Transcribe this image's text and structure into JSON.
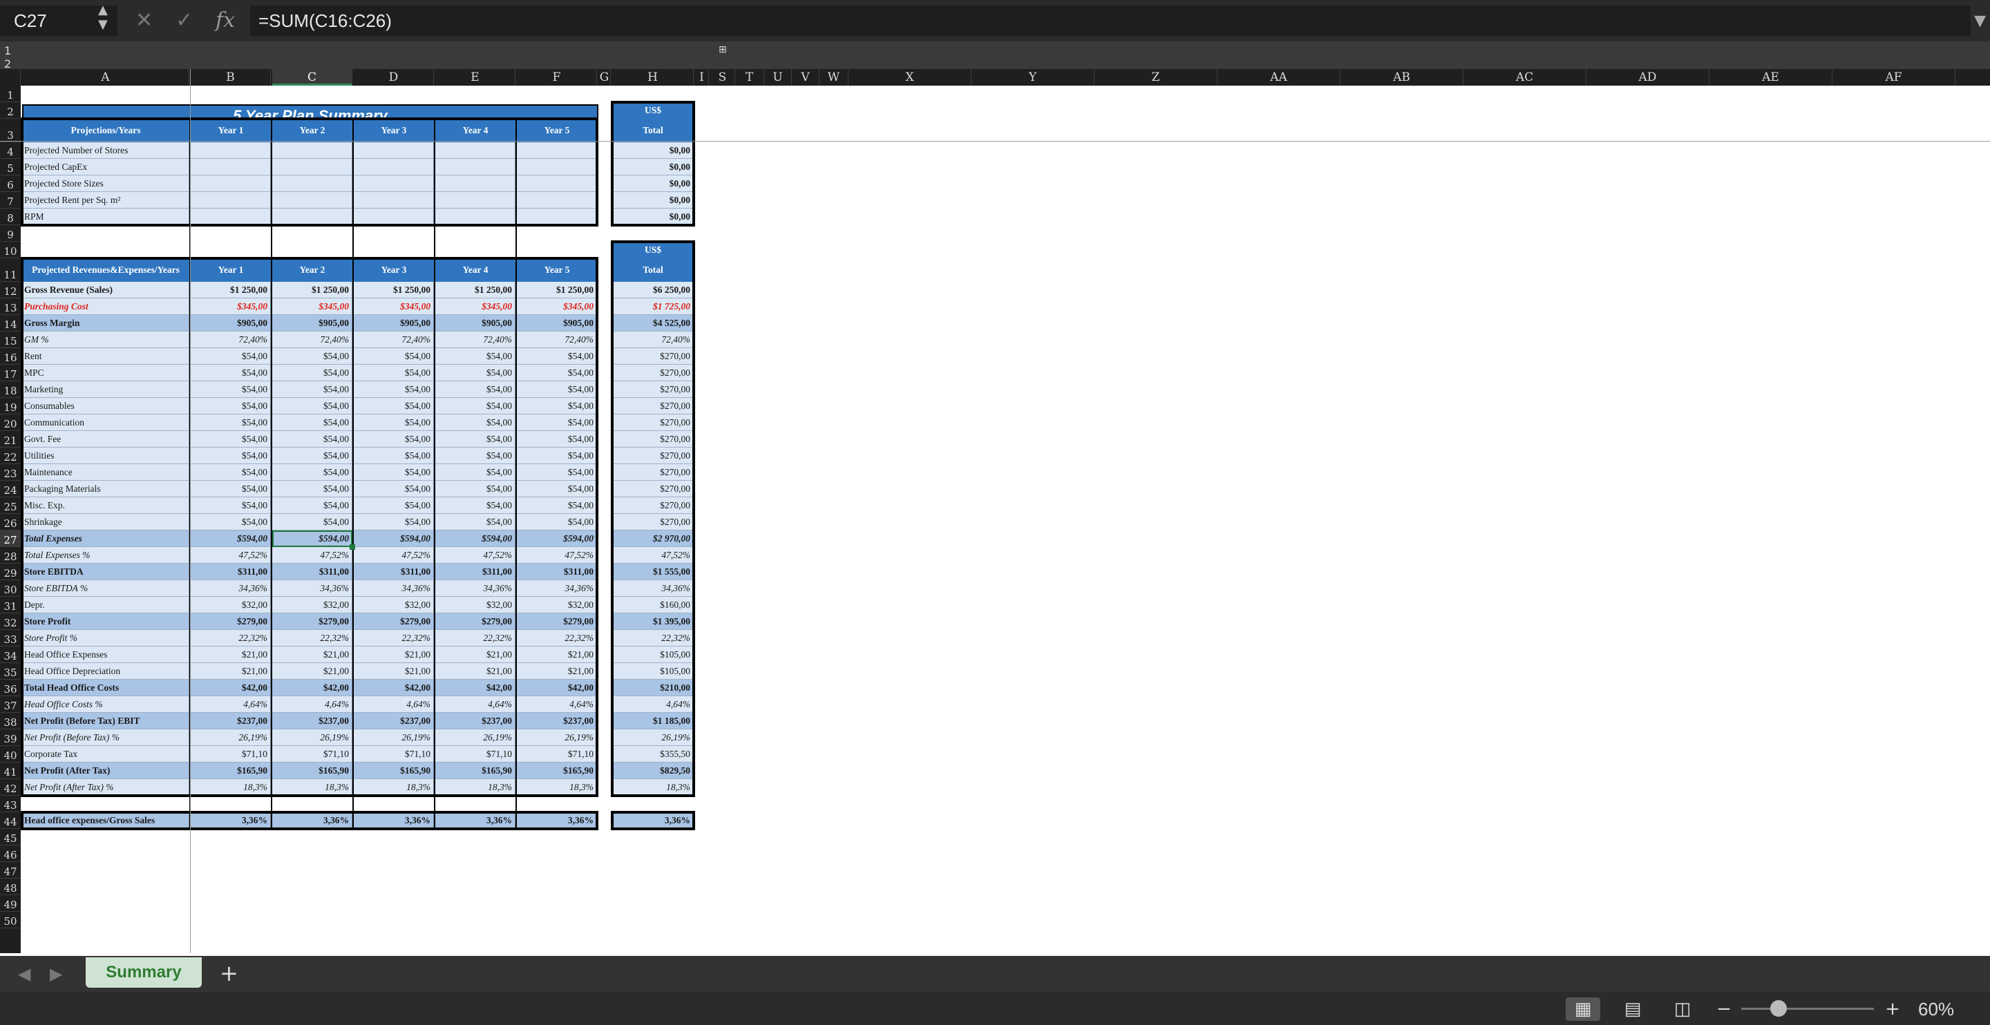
{
  "formula_bar": {
    "name_box": "C27",
    "formula": "=SUM(C16:C26)",
    "fx_label": "fx"
  },
  "columns": [
    "A",
    "B",
    "C",
    "D",
    "E",
    "F",
    "G",
    "H",
    "I",
    "S",
    "T",
    "U",
    "V",
    "W",
    "X",
    "Y",
    "Z",
    "AA",
    "AB",
    "AC",
    "AD",
    "AE",
    "AF"
  ],
  "selected_column": "C",
  "selected_row": 27,
  "rows": [
    1,
    2,
    3,
    4,
    5,
    6,
    7,
    8,
    9,
    10,
    11,
    12,
    13,
    14,
    15,
    16,
    17,
    18,
    19,
    20,
    21,
    22,
    23,
    24,
    25,
    26,
    27,
    28,
    29,
    30,
    31,
    32,
    33,
    34,
    35,
    36,
    37,
    38,
    39,
    40,
    41,
    42,
    43,
    44,
    45,
    46,
    47,
    48,
    49,
    50
  ],
  "sheet": {
    "title": "5 Year Plan Summary",
    "currency_label": "US$",
    "total_label": "Total",
    "years": [
      "Year 1",
      "Year 2",
      "Year 3",
      "Year 4",
      "Year 5"
    ],
    "projections": {
      "header": "Projections/Years",
      "rows": [
        {
          "label": "Projected Number of Stores",
          "total": "$0,00"
        },
        {
          "label": "Projected CapEx",
          "total": "$0,00"
        },
        {
          "label": "Projected Store Sizes",
          "total": "$0,00"
        },
        {
          "label": "Projected Rent per Sq. m²",
          "total": "$0,00"
        },
        {
          "label": "RPM",
          "total": "$0,00"
        }
      ]
    },
    "revenues": {
      "header": "Projected Revenues&Expenses/Years",
      "rows": [
        {
          "row": 12,
          "label": "Gross Revenue (Sales)",
          "style": "bold",
          "values": [
            "$1 250,00",
            "$1 250,00",
            "$1 250,00",
            "$1 250,00",
            "$1 250,00"
          ],
          "total": "$6 250,00"
        },
        {
          "row": 13,
          "label": "Purchasing Cost",
          "style": "red",
          "values": [
            "$345,00",
            "$345,00",
            "$345,00",
            "$345,00",
            "$345,00"
          ],
          "total": "$1 725,00"
        },
        {
          "row": 14,
          "label": "Gross Margin",
          "style": "mid",
          "values": [
            "$905,00",
            "$905,00",
            "$905,00",
            "$905,00",
            "$905,00"
          ],
          "total": "$4 525,00"
        },
        {
          "row": 15,
          "label": "GM %",
          "style": "italic",
          "values": [
            "72,40%",
            "72,40%",
            "72,40%",
            "72,40%",
            "72,40%"
          ],
          "total": "72,40%"
        },
        {
          "row": 16,
          "label": "Rent",
          "style": "plain",
          "values": [
            "$54,00",
            "$54,00",
            "$54,00",
            "$54,00",
            "$54,00"
          ],
          "total": "$270,00"
        },
        {
          "row": 17,
          "label": "MPC",
          "style": "plain",
          "values": [
            "$54,00",
            "$54,00",
            "$54,00",
            "$54,00",
            "$54,00"
          ],
          "total": "$270,00"
        },
        {
          "row": 18,
          "label": "Marketing",
          "style": "plain",
          "values": [
            "$54,00",
            "$54,00",
            "$54,00",
            "$54,00",
            "$54,00"
          ],
          "total": "$270,00"
        },
        {
          "row": 19,
          "label": "Consumables",
          "style": "plain",
          "values": [
            "$54,00",
            "$54,00",
            "$54,00",
            "$54,00",
            "$54,00"
          ],
          "total": "$270,00"
        },
        {
          "row": 20,
          "label": "Communication",
          "style": "plain",
          "values": [
            "$54,00",
            "$54,00",
            "$54,00",
            "$54,00",
            "$54,00"
          ],
          "total": "$270,00"
        },
        {
          "row": 21,
          "label": "Govt. Fee",
          "style": "plain",
          "values": [
            "$54,00",
            "$54,00",
            "$54,00",
            "$54,00",
            "$54,00"
          ],
          "total": "$270,00"
        },
        {
          "row": 22,
          "label": "Utilities",
          "style": "plain",
          "values": [
            "$54,00",
            "$54,00",
            "$54,00",
            "$54,00",
            "$54,00"
          ],
          "total": "$270,00"
        },
        {
          "row": 23,
          "label": "Maintenance",
          "style": "plain",
          "values": [
            "$54,00",
            "$54,00",
            "$54,00",
            "$54,00",
            "$54,00"
          ],
          "total": "$270,00"
        },
        {
          "row": 24,
          "label": "Packaging Materials",
          "style": "plain",
          "values": [
            "$54,00",
            "$54,00",
            "$54,00",
            "$54,00",
            "$54,00"
          ],
          "total": "$270,00"
        },
        {
          "row": 25,
          "label": "Misc. Exp.",
          "style": "plain",
          "values": [
            "$54,00",
            "$54,00",
            "$54,00",
            "$54,00",
            "$54,00"
          ],
          "total": "$270,00"
        },
        {
          "row": 26,
          "label": "Shrinkage",
          "style": "plain",
          "values": [
            "$54,00",
            "$54,00",
            "$54,00",
            "$54,00",
            "$54,00"
          ],
          "total": "$270,00"
        },
        {
          "row": 27,
          "label": "Total Expenses",
          "style": "mid-italic",
          "values": [
            "$594,00",
            "$594,00",
            "$594,00",
            "$594,00",
            "$594,00"
          ],
          "total": "$2 970,00"
        },
        {
          "row": 28,
          "label": "Total Expenses %",
          "style": "italic",
          "values": [
            "47,52%",
            "47,52%",
            "47,52%",
            "47,52%",
            "47,52%"
          ],
          "total": "47,52%"
        },
        {
          "row": 29,
          "label": "Store EBITDA",
          "style": "mid",
          "values": [
            "$311,00",
            "$311,00",
            "$311,00",
            "$311,00",
            "$311,00"
          ],
          "total": "$1 555,00"
        },
        {
          "row": 30,
          "label": "Store EBITDA %",
          "style": "italic",
          "values": [
            "34,36%",
            "34,36%",
            "34,36%",
            "34,36%",
            "34,36%"
          ],
          "total": "34,36%"
        },
        {
          "row": 31,
          "label": "Depr.",
          "style": "plain",
          "values": [
            "$32,00",
            "$32,00",
            "$32,00",
            "$32,00",
            "$32,00"
          ],
          "total": "$160,00"
        },
        {
          "row": 32,
          "label": "Store Profit",
          "style": "mid",
          "values": [
            "$279,00",
            "$279,00",
            "$279,00",
            "$279,00",
            "$279,00"
          ],
          "total": "$1 395,00"
        },
        {
          "row": 33,
          "label": "Store Profit %",
          "style": "italic",
          "values": [
            "22,32%",
            "22,32%",
            "22,32%",
            "22,32%",
            "22,32%"
          ],
          "total": "22,32%"
        },
        {
          "row": 34,
          "label": "Head Office Expenses",
          "style": "plain",
          "values": [
            "$21,00",
            "$21,00",
            "$21,00",
            "$21,00",
            "$21,00"
          ],
          "total": "$105,00"
        },
        {
          "row": 35,
          "label": "Head Office Depreciation",
          "style": "plain",
          "values": [
            "$21,00",
            "$21,00",
            "$21,00",
            "$21,00",
            "$21,00"
          ],
          "total": "$105,00"
        },
        {
          "row": 36,
          "label": "Total Head Office Costs",
          "style": "mid",
          "values": [
            "$42,00",
            "$42,00",
            "$42,00",
            "$42,00",
            "$42,00"
          ],
          "total": "$210,00"
        },
        {
          "row": 37,
          "label": "Head Office Costs %",
          "style": "italic",
          "values": [
            "4,64%",
            "4,64%",
            "4,64%",
            "4,64%",
            "4,64%"
          ],
          "total": "4,64%"
        },
        {
          "row": 38,
          "label": "Net Profit (Before Tax) EBIT",
          "style": "mid",
          "values": [
            "$237,00",
            "$237,00",
            "$237,00",
            "$237,00",
            "$237,00"
          ],
          "total": "$1 185,00"
        },
        {
          "row": 39,
          "label": "Net Profit (Before Tax) %",
          "style": "italic",
          "values": [
            "26,19%",
            "26,19%",
            "26,19%",
            "26,19%",
            "26,19%"
          ],
          "total": "26,19%"
        },
        {
          "row": 40,
          "label": "Corporate Tax",
          "style": "plain",
          "values": [
            "$71,10",
            "$71,10",
            "$71,10",
            "$71,10",
            "$71,10"
          ],
          "total": "$355,50"
        },
        {
          "row": 41,
          "label": "Net Profit (After Tax)",
          "style": "mid",
          "values": [
            "$165,90",
            "$165,90",
            "$165,90",
            "$165,90",
            "$165,90"
          ],
          "total": "$829,50"
        },
        {
          "row": 42,
          "label": "Net Profit (After Tax) %",
          "style": "italic",
          "values": [
            "18,3%",
            "18,3%",
            "18,3%",
            "18,3%",
            "18,3%"
          ],
          "total": "18,3%"
        }
      ],
      "ratio": {
        "row": 44,
        "label": "Head office expenses/Gross Sales",
        "values": [
          "3,36%",
          "3,36%",
          "3,36%",
          "3,36%",
          "3,36%"
        ],
        "total": "3,36%"
      }
    }
  },
  "tabs": {
    "active": "Summary",
    "add": "+"
  },
  "status": {
    "zoom": "60%",
    "zoom_level": 0.6
  }
}
